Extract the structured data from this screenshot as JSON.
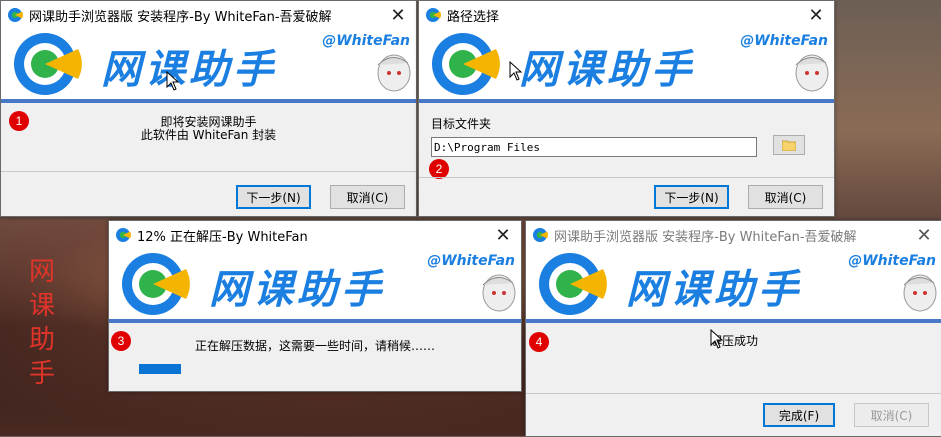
{
  "side_title": [
    "网",
    "课",
    "助",
    "手"
  ],
  "banner": {
    "product": "网课助手",
    "handle": "@WhiteFan"
  },
  "win1": {
    "title": "网课助手浏览器版 安装程序-By WhiteFan-吾爱破解",
    "close": "✕",
    "badge": "1",
    "line1": "即将安装网课助手",
    "line2": "此软件由 WhiteFan 封装",
    "next": "下一步(N)",
    "cancel": "取消(C)"
  },
  "win2": {
    "title": "路径选择",
    "close": "✕",
    "badge": "2",
    "folder_label": "目标文件夹",
    "path_value": "D:\\Program Files",
    "next": "下一步(N)",
    "cancel": "取消(C)"
  },
  "win3": {
    "title": "12% 正在解压-By WhiteFan",
    "close": "✕",
    "badge": "3",
    "status": "正在解压数据，这需要一些时间，请稍候……",
    "progress": 0.12
  },
  "win4": {
    "title": "网课助手浏览器版 安装程序-By WhiteFan-吾爱破解",
    "close": "✕",
    "badge": "4",
    "status": "解压成功",
    "finish": "完成(F)",
    "cancel": "取消(C)"
  },
  "colors": {
    "accent": "#1a7fe0",
    "badge": "#e00000",
    "progress": "#0a74d4",
    "banner_rule": "#4a78c8"
  },
  "icons": [
    "app-logo-icon",
    "close-icon",
    "folder-icon",
    "mouse-cursor-icon"
  ]
}
